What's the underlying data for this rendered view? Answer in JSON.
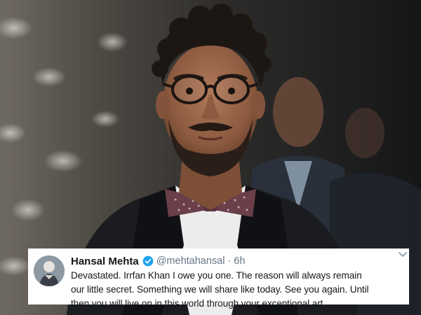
{
  "tweet": {
    "author_name": "Hansal Mehta",
    "handle": "@mehtahansal",
    "separator": "·",
    "time": "6h",
    "verified_color": "#1da1f2",
    "text_lines": [
      "Devastated. Irrfan Khan I owe you one. The reason will always remain",
      "our little secret. Something we will share like today. See you again. Until",
      "then you will live on in this world through your exceptional art."
    ]
  },
  "icons": {
    "verified": "verified-badge-icon",
    "more": "chevron-down-icon"
  }
}
